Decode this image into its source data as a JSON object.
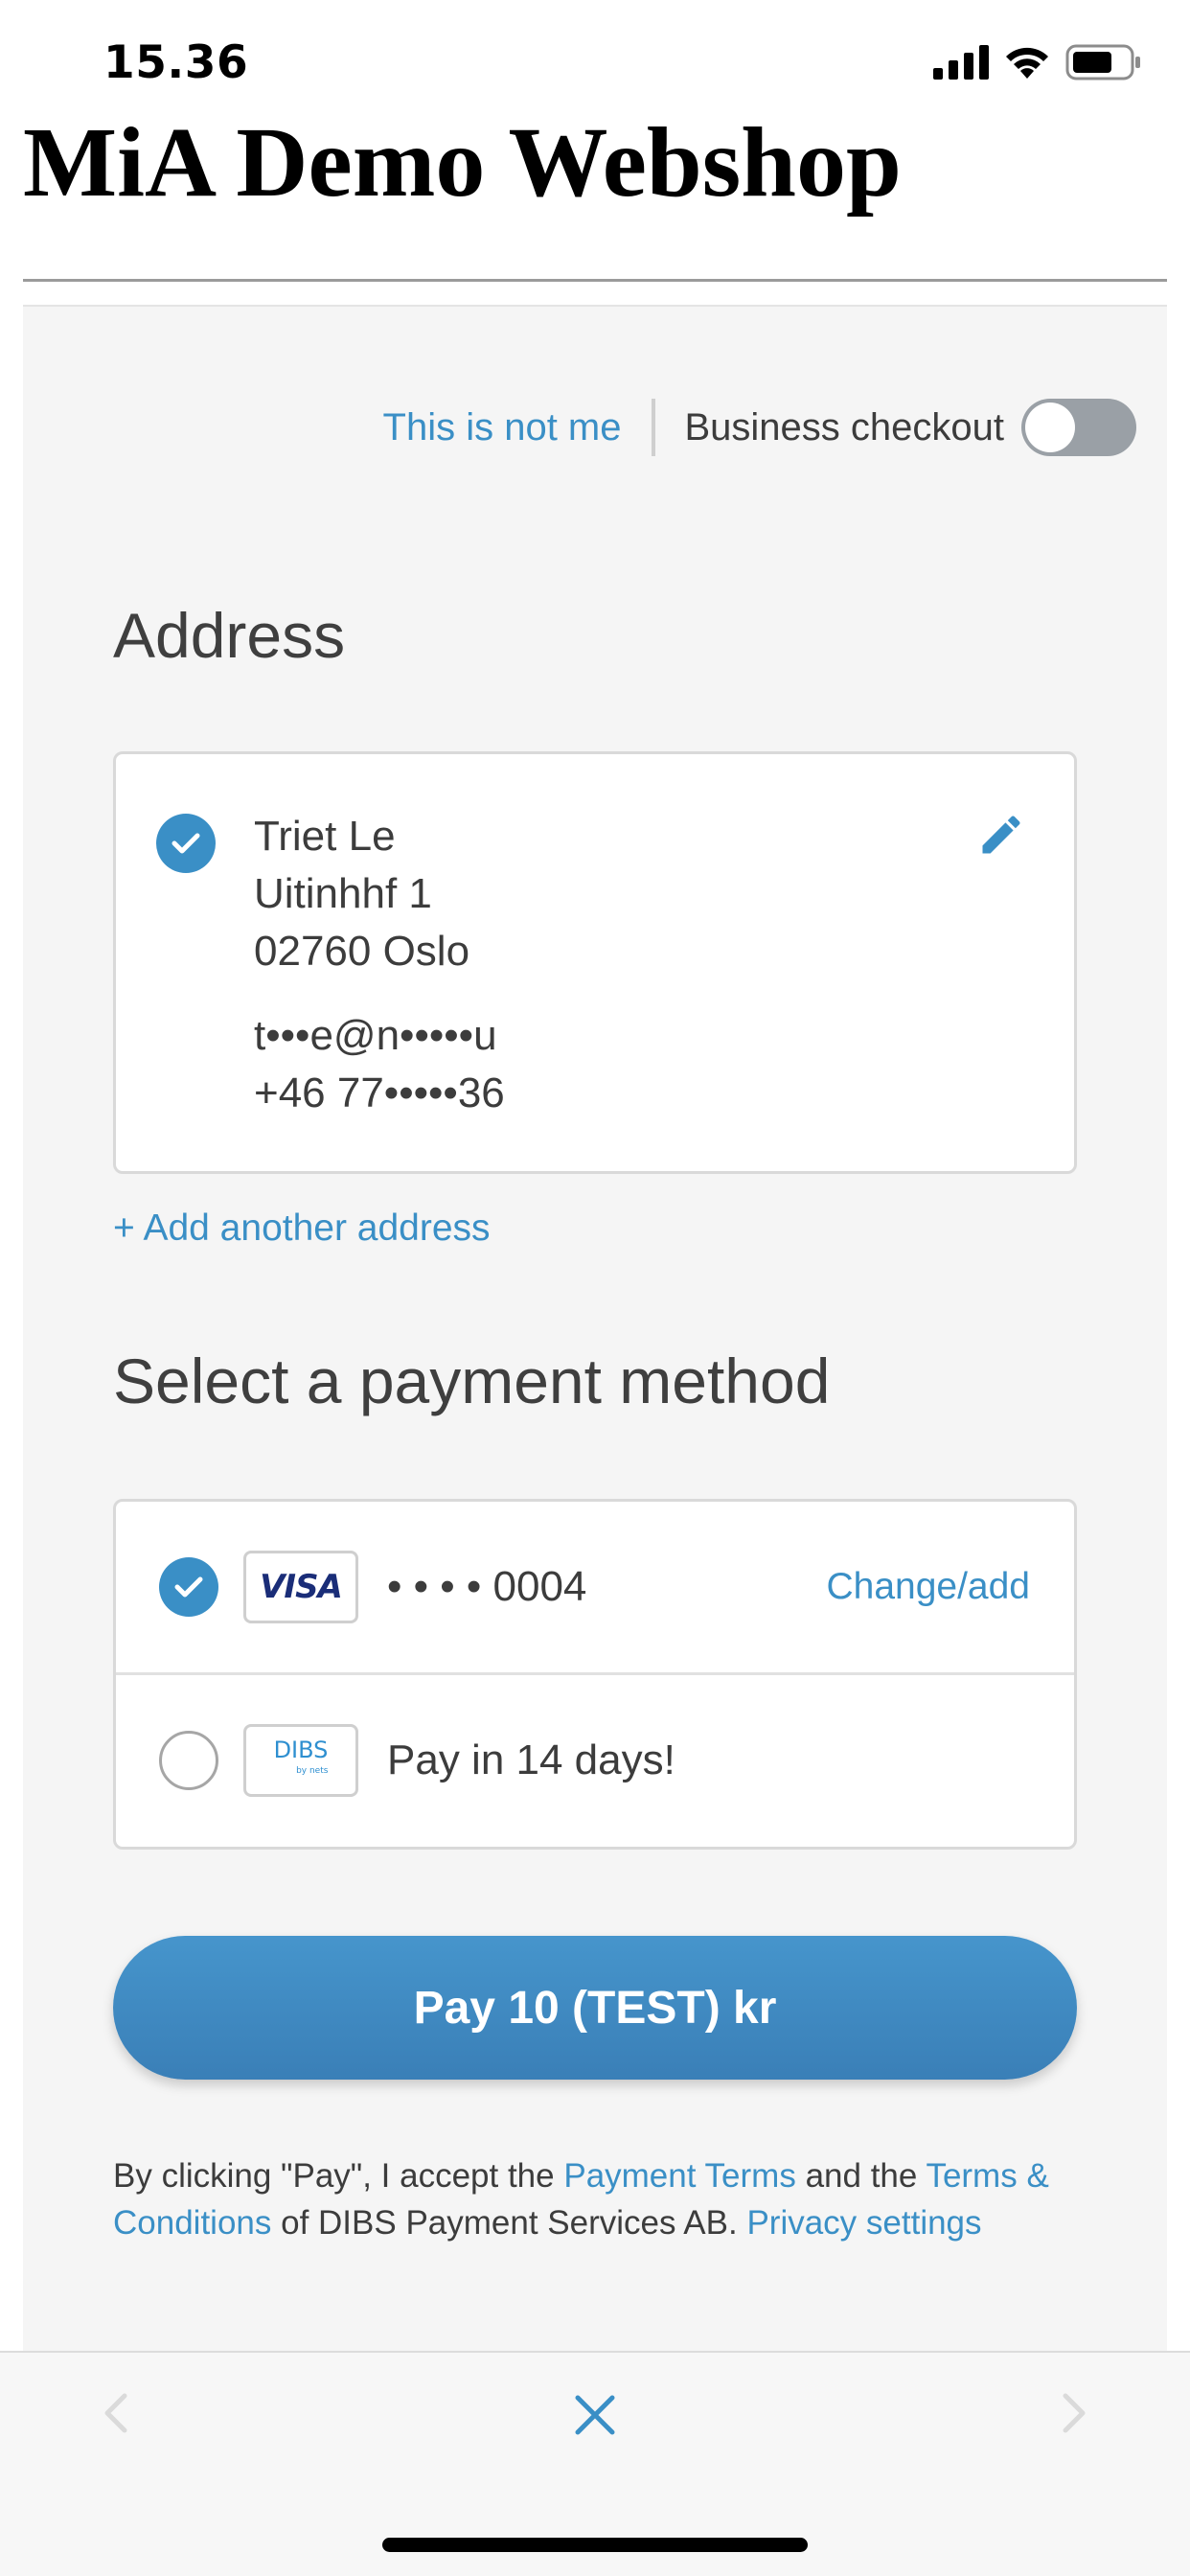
{
  "status_bar": {
    "time": "15.36"
  },
  "site": {
    "title": "MiA Demo Webshop"
  },
  "checkout": {
    "not_me_label": "This is not me",
    "business_checkout_label": "Business checkout",
    "business_checkout_enabled": false,
    "address_heading": "Address",
    "address": {
      "name": "Triet Le",
      "street": "Uitinhhf 1",
      "postal_city": "02760 Oslo",
      "email": "t•••e@n•••••u",
      "phone": "+46 77•••••36",
      "selected": true
    },
    "add_address_label": "+ Add another address",
    "payment_heading": "Select a payment method",
    "payment_methods": [
      {
        "logo": "VISA",
        "label": "• • • • 0004",
        "action": "Change/add",
        "selected": true
      },
      {
        "logo": "DIBS",
        "logo_sub": "by nets",
        "label": "Pay in 14 days!",
        "selected": false
      }
    ],
    "pay_button_label": "Pay 10 (TEST) kr",
    "legal": {
      "part1": "By clicking \"Pay\", I accept the ",
      "payment_terms": "Payment Terms",
      "part2": " and the ",
      "terms_conditions": "Terms & Conditions",
      "part3": " of DIBS Payment Services AB. ",
      "privacy_settings": "Privacy settings"
    }
  },
  "colors": {
    "accent": "#3a8fc6",
    "panel_bg": "#f5f5f5",
    "toggle_off": "#9aa0a6"
  },
  "icons": {
    "back": "chevron-left-icon",
    "close": "close-icon",
    "forward": "chevron-right-icon",
    "edit": "pencil-icon"
  }
}
